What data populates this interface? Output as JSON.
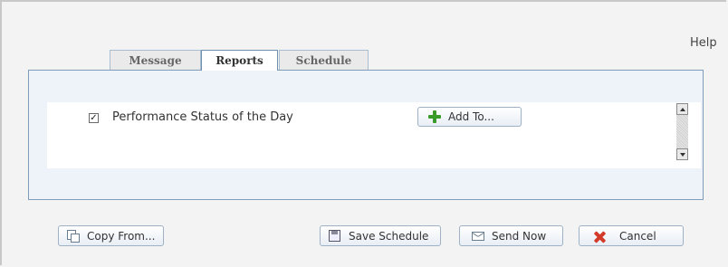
{
  "header": {
    "help_label": "Help"
  },
  "tabs": [
    {
      "label": "Message",
      "active": false
    },
    {
      "label": "Reports",
      "active": true
    },
    {
      "label": "Schedule",
      "active": false
    }
  ],
  "reports": {
    "items": [
      {
        "label": "Performance Status of the Day",
        "checked": true
      }
    ],
    "add_to_label": "Add To..."
  },
  "footer": {
    "copy_from_label": "Copy From...",
    "save_schedule_label": "Save Schedule",
    "send_now_label": "Send Now",
    "cancel_label": "Cancel"
  },
  "icons": {
    "add": "plus-icon",
    "copy": "copy-icon",
    "save": "save-disk-icon",
    "send": "envelope-icon",
    "cancel": "x-icon"
  },
  "colors": {
    "panel_border": "#7f9db9",
    "panel_bg": "#eef3f9",
    "plus_green": "#3a9a2a",
    "cancel_red": "#d23a2a"
  }
}
